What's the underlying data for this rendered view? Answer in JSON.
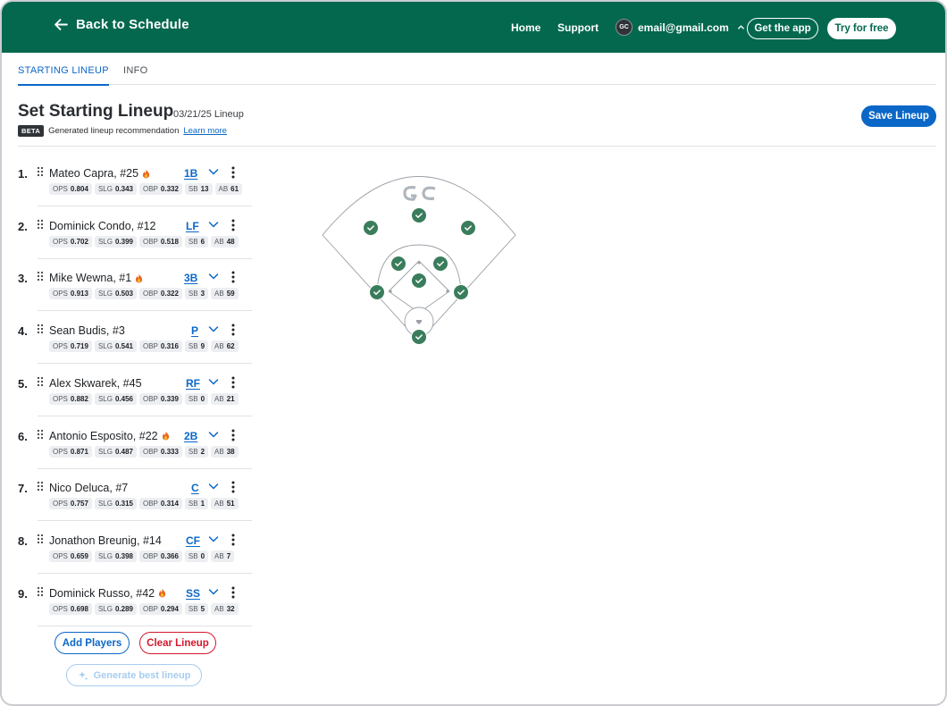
{
  "header": {
    "back_label": "Back to Schedule",
    "nav": {
      "home": "Home",
      "support": "Support"
    },
    "account": {
      "avatar_initials": "GC",
      "email": "email@gmail.com"
    },
    "get_app": "Get the app",
    "try_free": "Try for free",
    "brand_color": "#04684f"
  },
  "tabs": [
    {
      "label": "STARTING LINEUP",
      "active": true
    },
    {
      "label": "INFO",
      "active": false
    }
  ],
  "page": {
    "title": "Set Starting Lineup",
    "date": "03/21/25 Lineup",
    "beta_badge": "BETA",
    "beta_text": "Generated lineup recommendation",
    "learn_more": "Learn more",
    "save_label": "Save Lineup",
    "accent_color": "#0b67c7"
  },
  "stat_labels": {
    "ops": "OPS",
    "slg": "SLG",
    "obp": "OBP",
    "sb": "SB",
    "ab": "AB"
  },
  "lineup": [
    {
      "order": "1.",
      "name": "Mateo Capra, #25",
      "hot": true,
      "pos": "1B",
      "ops": "0.804",
      "slg": "0.343",
      "obp": "0.332",
      "sb": "13",
      "ab": "61"
    },
    {
      "order": "2.",
      "name": "Dominick Condo, #12",
      "hot": false,
      "pos": "LF",
      "ops": "0.702",
      "slg": "0.399",
      "obp": "0.518",
      "sb": "6",
      "ab": "48"
    },
    {
      "order": "3.",
      "name": "Mike Wewna, #1",
      "hot": true,
      "pos": "3B",
      "ops": "0.913",
      "slg": "0.503",
      "obp": "0.322",
      "sb": "3",
      "ab": "59"
    },
    {
      "order": "4.",
      "name": "Sean Budis, #3",
      "hot": false,
      "pos": "P",
      "ops": "0.719",
      "slg": "0.541",
      "obp": "0.316",
      "sb": "9",
      "ab": "62"
    },
    {
      "order": "5.",
      "name": "Alex Skwarek, #45",
      "hot": false,
      "pos": "RF",
      "ops": "0.882",
      "slg": "0.456",
      "obp": "0.339",
      "sb": "0",
      "ab": "21"
    },
    {
      "order": "6.",
      "name": "Antonio Esposito, #22",
      "hot": true,
      "pos": "2B",
      "ops": "0.871",
      "slg": "0.487",
      "obp": "0.333",
      "sb": "2",
      "ab": "38"
    },
    {
      "order": "7.",
      "name": "Nico Deluca, #7",
      "hot": false,
      "pos": "C",
      "ops": "0.757",
      "slg": "0.315",
      "obp": "0.314",
      "sb": "1",
      "ab": "51"
    },
    {
      "order": "8.",
      "name": "Jonathon Breunig, #14",
      "hot": false,
      "pos": "CF",
      "ops": "0.659",
      "slg": "0.398",
      "obp": "0.366",
      "sb": "0",
      "ab": "7"
    },
    {
      "order": "9.",
      "name": "Dominick Russo, #42",
      "hot": true,
      "pos": "SS",
      "ops": "0.698",
      "slg": "0.289",
      "obp": "0.294",
      "sb": "5",
      "ab": "32"
    }
  ],
  "actions": {
    "add_players": "Add Players",
    "clear_lineup": "Clear Lineup",
    "generate": "Generate best lineup"
  },
  "field": {
    "logo_text": "GC",
    "filled_positions": [
      "LF",
      "CF",
      "RF",
      "SS",
      "2B",
      "P",
      "3B",
      "1B",
      "C"
    ],
    "marker_color": "#3a7d5c"
  }
}
